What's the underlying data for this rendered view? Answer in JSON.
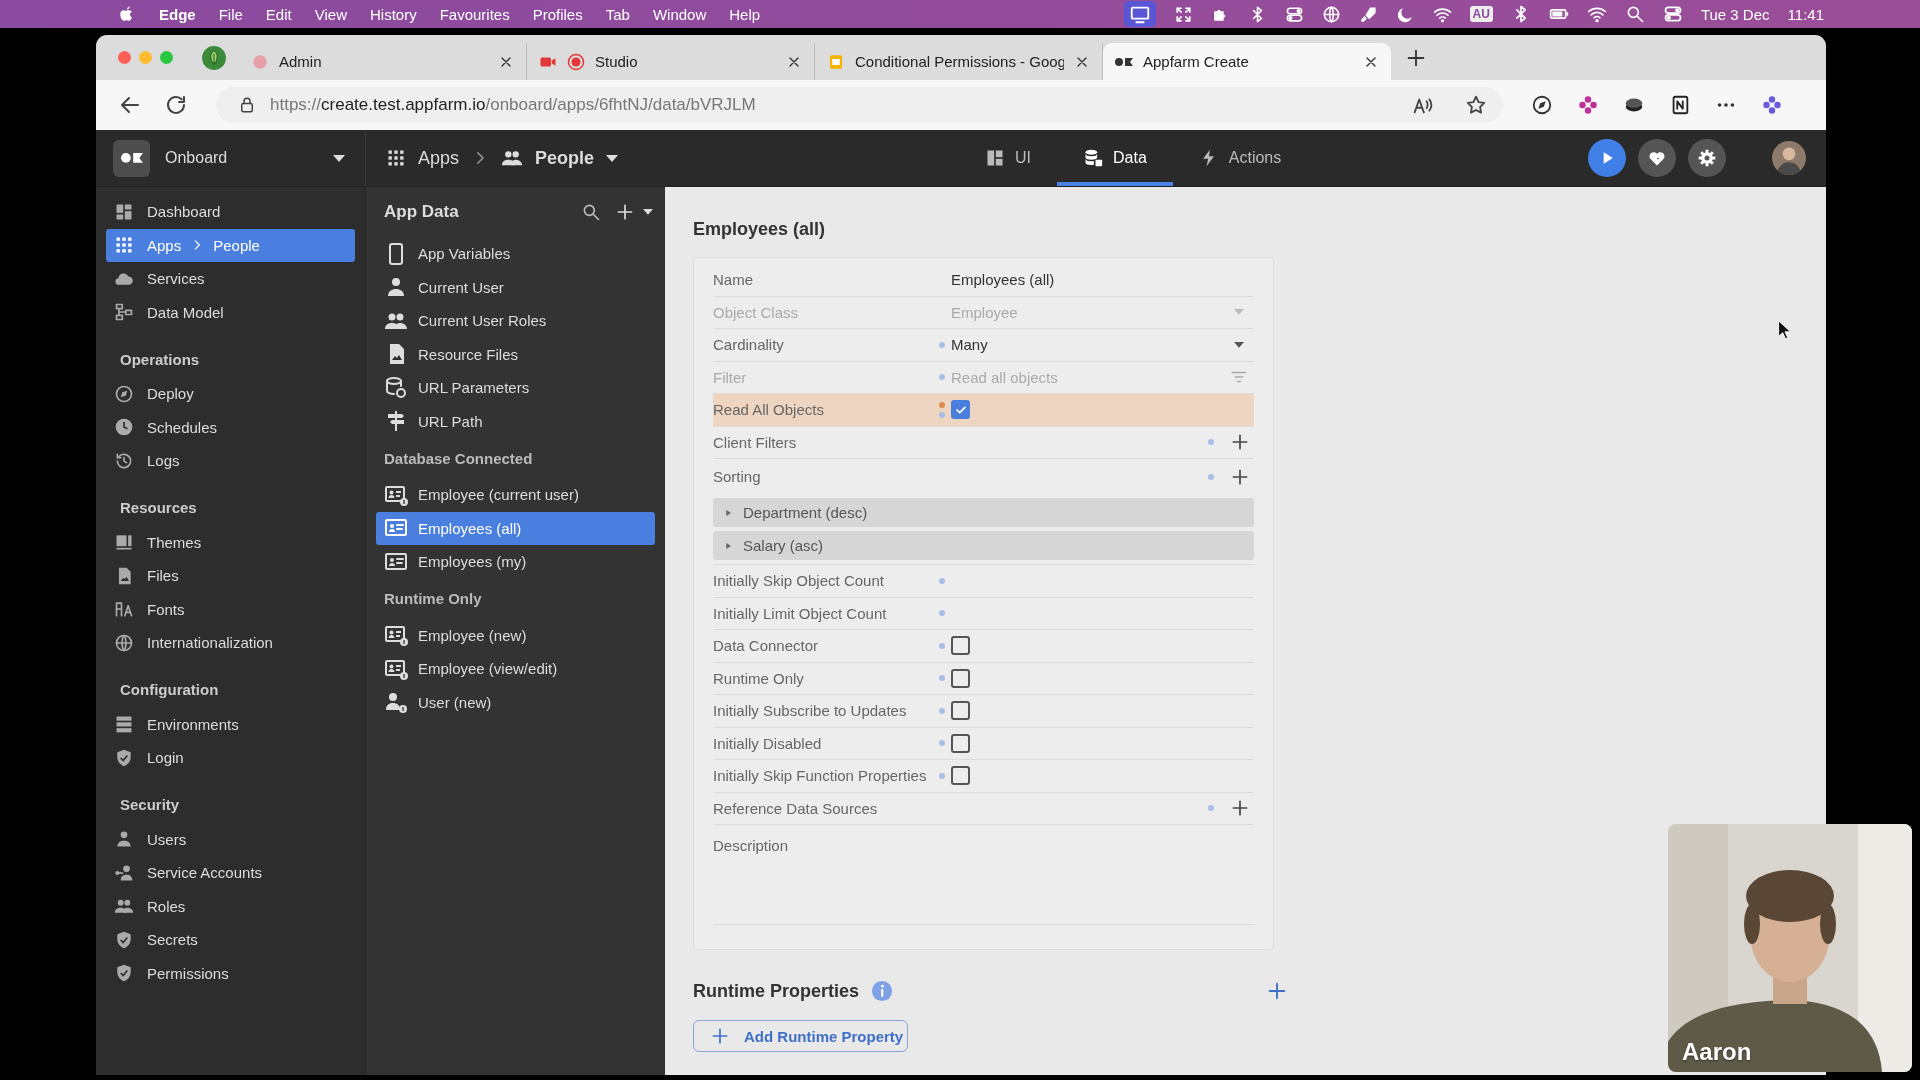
{
  "menubar": {
    "app_name": "Edge",
    "menus": [
      "File",
      "Edit",
      "View",
      "History",
      "Favourites",
      "Profiles",
      "Tab",
      "Window",
      "Help"
    ],
    "keyboard_badge": "AU",
    "date": "Tue 3 Dec",
    "time": "11:41"
  },
  "browser": {
    "tabs": [
      {
        "title": "Admin",
        "selected": false
      },
      {
        "title": "Studio",
        "selected": false
      },
      {
        "title": "Conditional Permissions - Goog",
        "selected": false
      },
      {
        "title": "Appfarm Create",
        "selected": true
      }
    ],
    "url_scheme": "https://",
    "url_host": "create.test.appfarm.io",
    "url_path": "/onboard/apps/6fhtNJ/data/bVRJLM"
  },
  "app_header": {
    "workspace": "Onboard",
    "crumbs": [
      "Apps",
      "People"
    ],
    "modes": [
      {
        "label": "UI",
        "selected": false
      },
      {
        "label": "Data",
        "selected": true
      },
      {
        "label": "Actions",
        "selected": false
      }
    ]
  },
  "sidebar": {
    "items": [
      {
        "kind": "item",
        "label": "Dashboard",
        "selected": false
      },
      {
        "kind": "item",
        "label": "Apps",
        "trail": "People",
        "selected": true
      },
      {
        "kind": "item",
        "label": "Services",
        "selected": false
      },
      {
        "kind": "item",
        "label": "Data Model",
        "selected": false
      },
      {
        "kind": "heading",
        "label": "Operations"
      },
      {
        "kind": "item",
        "label": "Deploy",
        "selected": false
      },
      {
        "kind": "item",
        "label": "Schedules",
        "selected": false
      },
      {
        "kind": "item",
        "label": "Logs",
        "selected": false
      },
      {
        "kind": "heading",
        "label": "Resources"
      },
      {
        "kind": "item",
        "label": "Themes",
        "selected": false
      },
      {
        "kind": "item",
        "label": "Files",
        "selected": false
      },
      {
        "kind": "item",
        "label": "Fonts",
        "selected": false
      },
      {
        "kind": "item",
        "label": "Internationalization",
        "selected": false
      },
      {
        "kind": "heading",
        "label": "Configuration"
      },
      {
        "kind": "item",
        "label": "Environments",
        "selected": false
      },
      {
        "kind": "item",
        "label": "Login",
        "selected": false
      },
      {
        "kind": "heading",
        "label": "Security"
      },
      {
        "kind": "item",
        "label": "Users",
        "selected": false
      },
      {
        "kind": "item",
        "label": "Service Accounts",
        "selected": false
      },
      {
        "kind": "item",
        "label": "Roles",
        "selected": false
      },
      {
        "kind": "item",
        "label": "Secrets",
        "selected": false
      },
      {
        "kind": "item",
        "label": "Permissions",
        "selected": false
      }
    ]
  },
  "data_panel": {
    "title": "App Data",
    "groups": [
      {
        "items": [
          {
            "label": "App Variables",
            "selected": false
          },
          {
            "label": "Current User",
            "selected": false
          },
          {
            "label": "Current User Roles",
            "selected": false
          },
          {
            "label": "Resource Files",
            "selected": false
          },
          {
            "label": "URL Parameters",
            "selected": false
          },
          {
            "label": "URL Path",
            "selected": false
          }
        ]
      },
      {
        "heading": "Database Connected",
        "items": [
          {
            "label": "Employee (current user)",
            "selected": false,
            "single": true
          },
          {
            "label": "Employees (all)",
            "selected": true,
            "single": false
          },
          {
            "label": "Employees (my)",
            "selected": false,
            "single": false
          }
        ]
      },
      {
        "heading": "Runtime Only",
        "items": [
          {
            "label": "Employee (new)",
            "selected": false,
            "single": true
          },
          {
            "label": "Employee (view/edit)",
            "selected": false,
            "single": true
          },
          {
            "label": "User (new)",
            "selected": false,
            "single": true
          }
        ]
      }
    ]
  },
  "details": {
    "title": "Employees (all)",
    "rows": [
      {
        "kind": "text",
        "label": "Name",
        "value": "Employees (all)",
        "dot": false
      },
      {
        "kind": "select",
        "label": "Object Class",
        "value": "Employee",
        "disabled": true,
        "dot": false
      },
      {
        "kind": "select",
        "label": "Cardinality",
        "value": "Many",
        "disabled": false,
        "dot": true
      },
      {
        "kind": "filter",
        "label": "Filter",
        "placeholder": "Read all objects",
        "disabled": true,
        "dot": true
      },
      {
        "kind": "checkbox",
        "label": "Read All Objects",
        "checked": true,
        "highlighted": true,
        "flag": true,
        "dot": true
      },
      {
        "kind": "add",
        "label": "Client Filters",
        "dot": true
      },
      {
        "kind": "sort",
        "label": "Sorting",
        "dot": true,
        "items": [
          "Department (desc)",
          "Salary (asc)"
        ]
      },
      {
        "kind": "empty",
        "label": "Initially Skip Object Count",
        "dot": true
      },
      {
        "kind": "empty",
        "label": "Initially Limit Object Count",
        "dot": true
      },
      {
        "kind": "checkbox",
        "label": "Data Connector",
        "checked": false,
        "highlighted": false,
        "flag": false,
        "dot": true
      },
      {
        "kind": "checkbox",
        "label": "Runtime Only",
        "checked": false,
        "highlighted": false,
        "flag": false,
        "dot": true
      },
      {
        "kind": "checkbox",
        "label": "Initially Subscribe to Updates",
        "checked": false,
        "highlighted": false,
        "flag": false,
        "dot": true
      },
      {
        "kind": "checkbox",
        "label": "Initially Disabled",
        "checked": false,
        "highlighted": false,
        "flag": false,
        "dot": true
      },
      {
        "kind": "checkbox",
        "label": "Initially Skip Function Properties",
        "checked": false,
        "highlighted": false,
        "flag": false,
        "dot": true
      },
      {
        "kind": "add",
        "label": "Reference Data Sources",
        "dot": true
      },
      {
        "kind": "description",
        "label": "Description"
      }
    ],
    "runtime_title": "Runtime Properties",
    "runtime_button": "Add Runtime Property"
  },
  "webcam": {
    "kind": "picture",
    "name": "Aaron"
  }
}
